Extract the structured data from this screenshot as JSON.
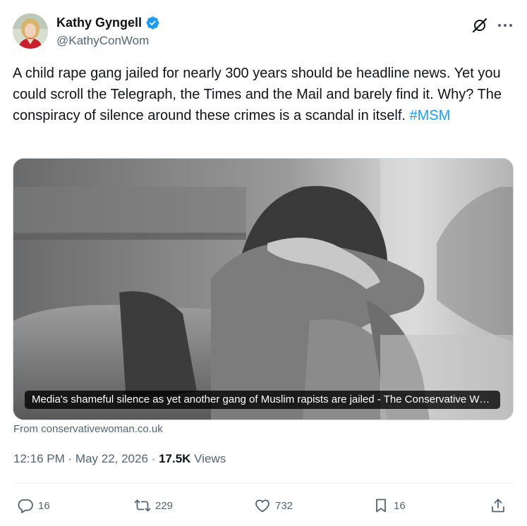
{
  "author": {
    "name": "Kathy Gyngell",
    "handle": "@KathyConWom",
    "verified": true
  },
  "icons": {
    "verified": "verified-badge-icon",
    "grok": "grok-icon",
    "more": "more-options-icon",
    "reply": "reply-icon",
    "repost": "repost-icon",
    "like": "like-icon",
    "bookmark": "bookmark-icon",
    "share": "share-icon"
  },
  "tweet": {
    "text": "A child rape gang jailed for nearly 300 years should be headline news. Yet you could scroll the Telegraph, the Times and the Mail and barely find it.  Why? The conspiracy of silence around these crimes is a scandal in itself.",
    "hashtag": "#MSM"
  },
  "card": {
    "caption": "Media's shameful silence as yet another gang of Muslim rapists are jailed - The Conservative Woman",
    "source": "From conservativewoman.co.uk"
  },
  "meta": {
    "time": "12:16 PM",
    "separator": "·",
    "date": "May 22, 2026",
    "views_count": "17.5K",
    "views_label": "Views"
  },
  "actions": {
    "replies": "16",
    "reposts": "229",
    "likes": "732",
    "bookmarks": "16"
  },
  "colors": {
    "accent": "#1d9bf0",
    "text": "#0f1419",
    "secondary": "#536471",
    "border": "#cfd9de"
  }
}
